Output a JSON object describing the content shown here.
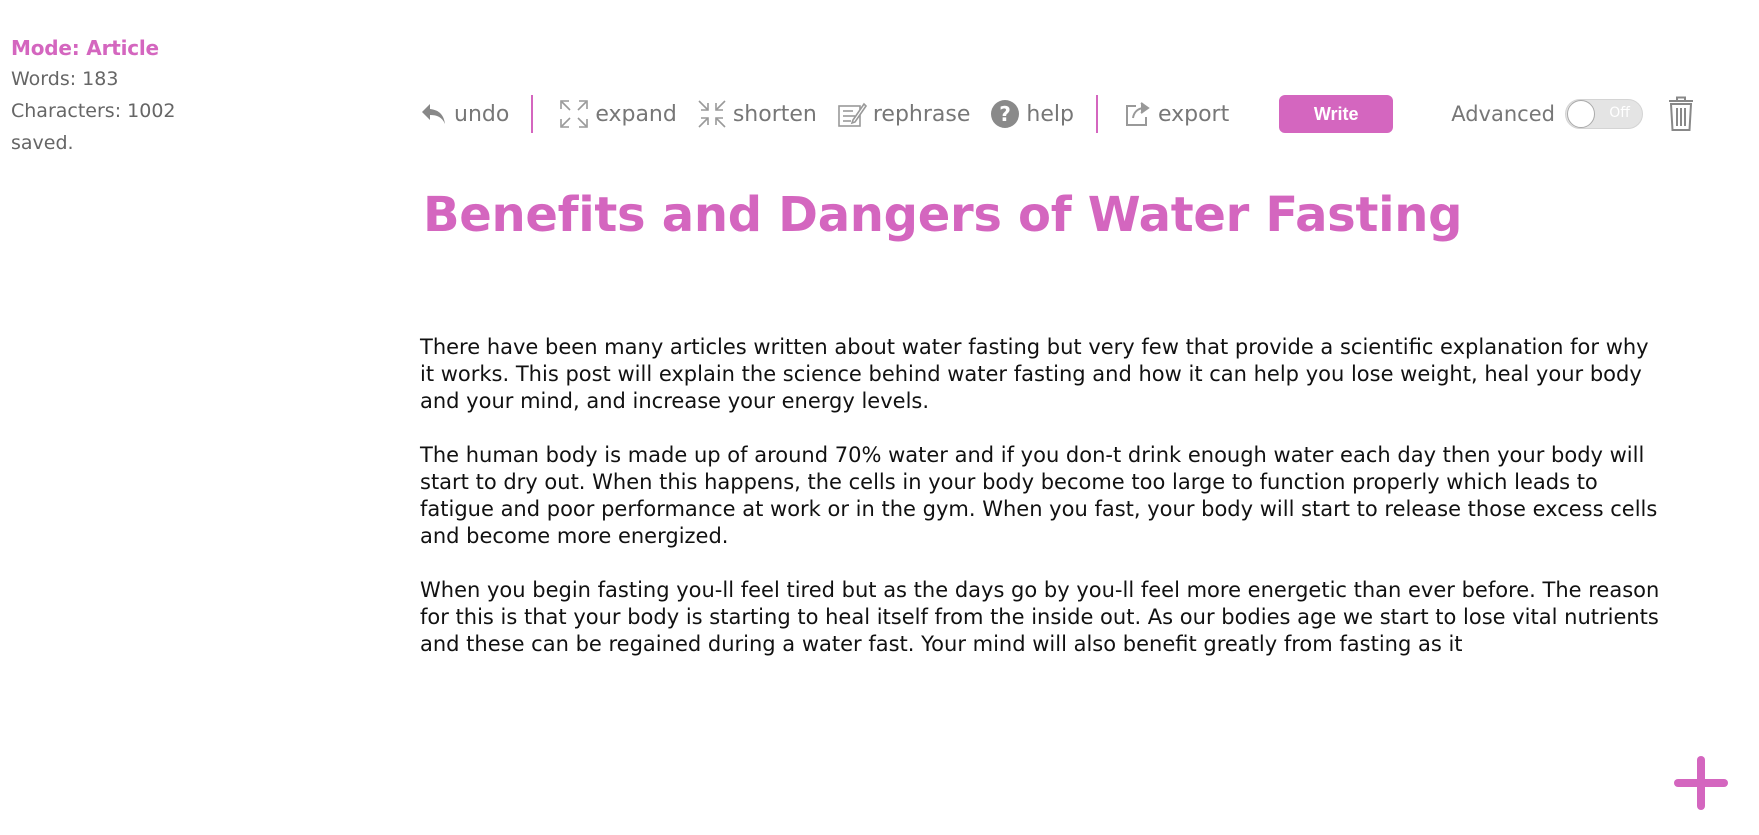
{
  "sidebar": {
    "mode": "Mode: Article",
    "words": "Words: 183",
    "characters": "Characters: 1002",
    "status": "saved."
  },
  "toolbar": {
    "undo": "undo",
    "expand": "expand",
    "shorten": "shorten",
    "rephrase": "rephrase",
    "help": "help",
    "export": "export",
    "write": "Write",
    "advanced_label": "Advanced",
    "advanced_state": "Off",
    "icons": [
      "undo-icon",
      "expand-icon",
      "shorten-icon",
      "rephrase-icon",
      "help-icon",
      "export-icon",
      "trash-icon",
      "plus-icon"
    ]
  },
  "document": {
    "title": "Benefits and Dangers of Water Fasting",
    "paragraphs": [
      "There have been many articles written about water fasting but very few that provide a scientific explanation for why it works. This post will explain the science behind water fasting and how it can help you lose weight, heal your body and your mind, and increase your energy levels.",
      "The human body is made up of around 70% water and if you don-t drink enough water each day then your body will start to dry out. When this happens, the cells in your body become too large to function properly which leads to fatigue and poor performance at work or in the gym. When you fast, your body will start to release those excess cells and become more energized.",
      "When you begin fasting you-ll feel tired but as the days go by you-ll feel more energetic than ever before.  The reason for this is that your body is starting to heal itself from the inside out. As our bodies age we start to lose vital nutrients and these can be regained during a water fast. Your mind will also benefit greatly from fasting as it"
    ]
  },
  "colors": {
    "accent": "#d466bf",
    "toolbar_text": "#777777",
    "body_text": "#111111"
  }
}
